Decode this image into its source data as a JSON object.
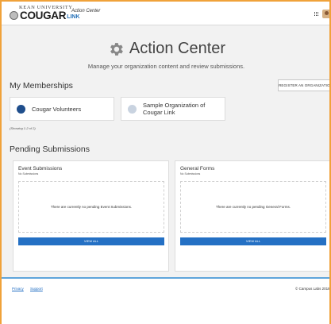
{
  "header": {
    "university": "KEAN UNIVERSITY",
    "logo_main": "COUGAR",
    "logo_link": "LINK",
    "app_title": "Action Center"
  },
  "hero": {
    "title": "Action Center",
    "subtitle": "Manage your organization content and review submissions."
  },
  "memberships": {
    "title": "My Memberships",
    "register_label": "REGISTER AN ORGANIZATION",
    "orgs": [
      {
        "name": "Cougar Volunteers",
        "icon_color": "#1f4e8c"
      },
      {
        "name": "Sample Organization of Cougar Link",
        "icon_color": "#c9d3e0"
      }
    ],
    "showing": "(Showing 1-2 of 2)"
  },
  "pending": {
    "title": "Pending Submissions",
    "panels": [
      {
        "title": "Event Submissions",
        "sub": "No Submissions",
        "message": "There are currently no pending Event Submissions.",
        "button": "VIEW ALL"
      },
      {
        "title": "General Forms",
        "sub": "No Submissions",
        "message": "There are currently no pending General Forms.",
        "button": "VIEW ALL"
      }
    ]
  },
  "footer": {
    "privacy": "Privacy",
    "support": "Support",
    "copyright": "© Campus Labs 2018"
  },
  "colors": {
    "accent": "#2470c4",
    "frame": "#f0a23a",
    "footer_rule": "#5fa5db"
  }
}
